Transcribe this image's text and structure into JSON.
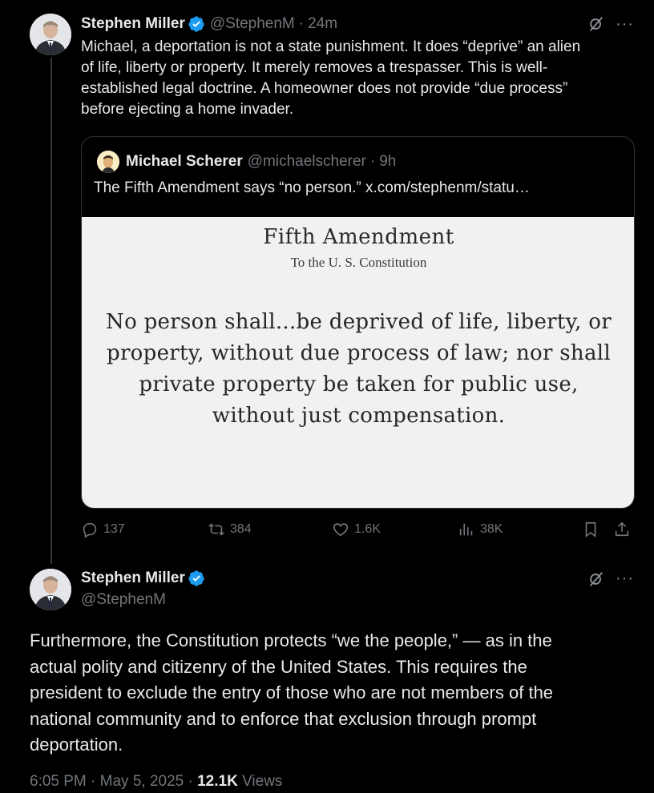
{
  "tweet1": {
    "author_name": "Stephen Miller",
    "handle": "@StephenM",
    "separator": "·",
    "time": "24m",
    "text_lines": [
      "Michael, a deportation is not a state punishment. It does “deprive” an alien",
      "of life, liberty or property. It merely removes a trespasser. This is well-",
      "established legal doctrine. A homeowner does not provide “due process”",
      "before ejecting a home invader."
    ],
    "quote": {
      "author_name": "Michael Scherer",
      "handle": "@michaelscherer",
      "separator": "·",
      "time": "9h",
      "text": "The Fifth Amendment says “no person.”  x.com/stephenm/statu…",
      "image": {
        "title": "Fifth Amendment",
        "subtitle": "To the U. S. Constitution",
        "body_lines": [
          "No person shall...be deprived of life, liberty, or",
          "property, without due process of law; nor shall",
          "private property be taken for public use,",
          "without just compensation."
        ]
      }
    },
    "actions": {
      "replies": "137",
      "reposts": "384",
      "likes": "1.6K",
      "views": "38K"
    }
  },
  "tweet2": {
    "author_name": "Stephen Miller",
    "handle": "@StephenM",
    "text_lines": [
      "Furthermore, the Constitution protects “we the people,” — as in the",
      "actual polity and citizenry of the United States.  This requires the",
      "president to exclude the entry of those who are not members of the",
      "national community and to enforce that exclusion through prompt",
      "deportation."
    ],
    "timestamp": "6:05 PM · May 5, 2025 · ",
    "views_count": "12.1K",
    "views_label": " Views"
  },
  "icons": {
    "verified": "verified-badge-icon",
    "grok": "grok-icon",
    "more": "more-icon",
    "reply": "reply-icon",
    "repost": "repost-icon",
    "like": "like-icon",
    "views": "views-icon",
    "bookmark": "bookmark-icon",
    "share": "share-icon"
  },
  "colors": {
    "background": "#000000",
    "text": "#e7e9ea",
    "secondary": "#71767b",
    "verified": "#1d9bf0",
    "border": "#2f3336"
  },
  "more_glyph": "···"
}
